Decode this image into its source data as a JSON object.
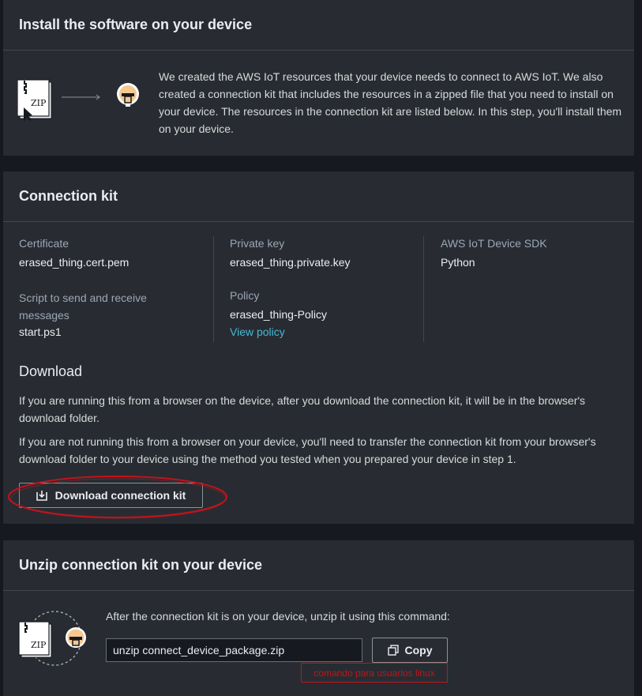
{
  "install": {
    "title": "Install the software on your device",
    "description": "We created the AWS IoT resources that your device needs to connect to AWS IoT. We also created a connection kit that includes the resources in a zipped file that you need to install on your device. The resources in the connection kit are listed below. In this step, you'll install them on your device.",
    "zip_label": "ZIP"
  },
  "kit": {
    "title": "Connection kit",
    "certificate_label": "Certificate",
    "certificate_value": "erased_thing.cert.pem",
    "script_label": "Script to send and receive messages",
    "script_value": "start.ps1",
    "private_key_label": "Private key",
    "private_key_value": "erased_thing.private.key",
    "policy_label": "Policy",
    "policy_value": "erased_thing-Policy",
    "view_policy": "View policy",
    "sdk_label": "AWS IoT Device SDK",
    "sdk_value": "Python",
    "download_heading": "Download",
    "download_p1": "If you are running this from a browser on the device, after you download the connection kit, it will be in the browser's download folder.",
    "download_p2": "If you are not running this from a browser on your device, you'll need to transfer the connection kit from your browser's download folder to your device using the method you tested when you prepared your device in step 1.",
    "download_button": "Download connection kit"
  },
  "unzip": {
    "title": "Unzip connection kit on your device",
    "instruction": "After the connection kit is on your device, unzip it using this command:",
    "command": "unzip connect_device_package.zip",
    "copy_button": "Copy",
    "annotation": "comando para usuarios linux",
    "zip_label": "ZIP"
  },
  "colors": {
    "annotation_red": "#c0141c",
    "link": "#44b9d6",
    "panel": "#282c32",
    "background": "#16191f"
  }
}
